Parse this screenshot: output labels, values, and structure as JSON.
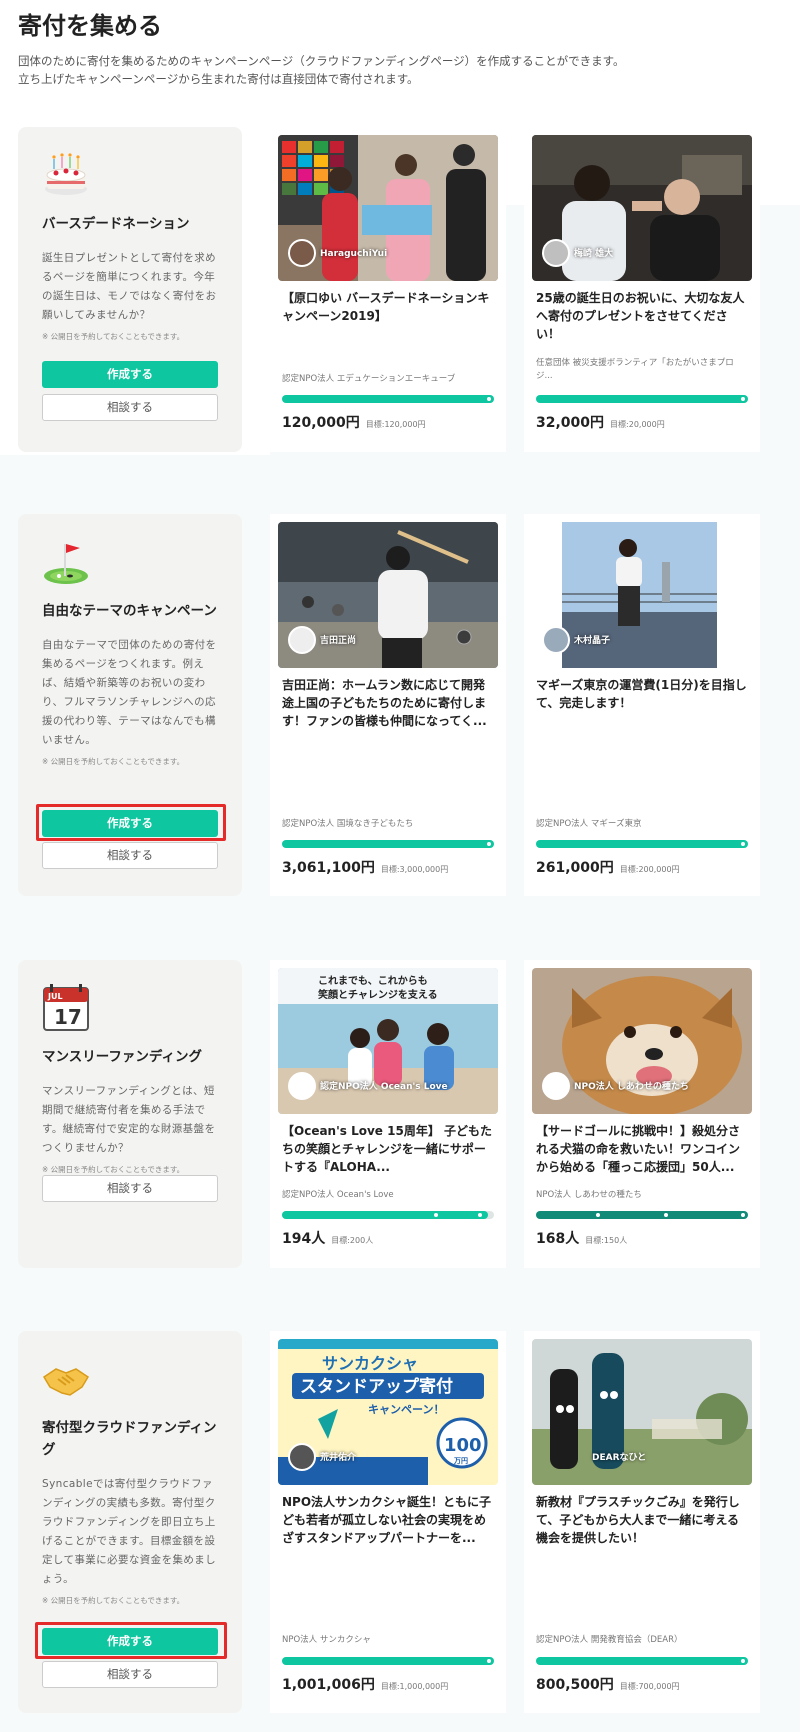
{
  "page": {
    "title": "寄付を集める",
    "intro_line1": "団体のために寄付を集めるためのキャンペーンページ（クラウドファンディングページ）を作成することができます。",
    "intro_line2": "立ち上げたキャンペーンページから生まれた寄付は直接団体で寄付されます。"
  },
  "colors": {
    "accent": "#0ec6a0",
    "highlight": "#e52a2a",
    "side_bg": "#f3f4f2"
  },
  "sections": [
    {
      "icon": "birthday-cake-icon",
      "title": "バースデードネーション",
      "desc": "誕生日プレゼントとして寄付を求めるページを簡単につくれます。今年の誕生日は、モノではなく寄付をお願いしてみませんか？",
      "note": "※ 公開日を予約しておくこともできます。",
      "create_label": "作成する",
      "consult_label": "相談する",
      "cards": [
        {
          "owner": "HaraguchiYui",
          "title": "【原口ゆい バースデードネーションキャンペーン2019】",
          "org": "認定NPO法人 エデュケーションエーキューブ",
          "amount": "120,000円",
          "goal": "目標:120,000円",
          "progress": 1.0
        },
        {
          "owner": "梅崎 雄大",
          "title": "25歳の誕生日のお祝いに、大切な友人へ寄付のプレゼントをさせてください！",
          "org": "任意団体 被災支援ボランティア「おたがいさまプロジ...",
          "amount": "32,000円",
          "goal": "目標:20,000円",
          "progress": 1.0
        }
      ]
    },
    {
      "icon": "golf-flag-icon",
      "title": "自由なテーマのキャンペーン",
      "desc": "自由なテーマで団体のための寄付を集めるページをつくれます。例えば、結婚や新築等のお祝いの変わり、フルマラソンチャレンジへの応援の代わり等、テーマはなんでも構いません。",
      "note": "※ 公開日を予約しておくこともできます。",
      "create_label": "作成する",
      "consult_label": "相談する",
      "cards": [
        {
          "owner": "吉田正尚",
          "title": "吉田正尚：ホームラン数に応じて開発途上国の子どもたちのために寄付します！ファンの皆様も仲間になってく...",
          "org": "認定NPO法人 国境なき子どもたち",
          "amount": "3,061,100円",
          "goal": "目標:3,000,000円",
          "progress": 1.0
        },
        {
          "owner": "木村晶子",
          "title": "マギーズ東京の運営費(1日分)を目指して、完走します！",
          "org": "認定NPO法人 マギーズ東京",
          "amount": "261,000円",
          "goal": "目標:200,000円",
          "progress": 1.0
        }
      ]
    },
    {
      "icon": "calendar-icon",
      "calendar_month": "JUL",
      "calendar_day": "17",
      "title": "マンスリーファンディング",
      "desc": "マンスリーファンディングとは、短期間で継続寄付者を集める手法です。継続寄付で安定的な財源基盤をつくりませんか？",
      "note": "※ 公開日を予約しておくこともできます。",
      "consult_label": "相談する",
      "cards": [
        {
          "owner": "認定NPO法人 Ocean's Love",
          "img_text1": "これまでも、これからも",
          "img_text2": "笑顔とチャレンジを支える",
          "title": "【Ocean's Love 15周年】 子どもたちの笑顔とチャレンジを一緒にサポートする『ALOHA...",
          "org": "認定NPO法人 Ocean's Love",
          "amount": "194人",
          "goal": "目標:200人",
          "progress": 0.97
        },
        {
          "owner": "NPO法人 しあわせの種たち",
          "title": "【サードゴールに挑戦中！】殺処分される犬猫の命を救いたい！ワンコインから始める「種っこ応援団」50人...",
          "org": "NPO法人 しあわせの種たち",
          "amount": "168人",
          "goal": "目標:150人",
          "progress": 1.0
        }
      ]
    },
    {
      "icon": "handshake-icon",
      "title": "寄付型クラウドファンディング",
      "desc": "Syncableでは寄付型クラウドファンディングの実績も多数。寄付型クラウドファンディングを即日立ち上げることができます。目標金額を設定して事業に必要な資金を集めましょう。",
      "note": "※ 公開日を予約しておくこともできます。",
      "create_label": "作成する",
      "consult_label": "相談する",
      "cards": [
        {
          "owner": "荒井佑介",
          "img_text1": "サンカクシャ",
          "img_text2": "スタンドアップ寄付",
          "img_text3": "キャンペーン！",
          "img_text4": "100",
          "img_text5": "万円",
          "title": "NPO法人サンカクシャ誕生！ともに子ども若者が孤立しない社会の実現をめざすスタンドアップパートナーを...",
          "org": "NPO法人 サンカクシャ",
          "amount": "1,001,006円",
          "goal": "目標:1,000,000円",
          "progress": 1.0
        },
        {
          "owner": "DEARなひと",
          "title": "新教材『プラスチックごみ』を発行して、子どもから大人まで一緒に考える機会を提供したい！",
          "org": "認定NPO法人 開発教育協会（DEAR）",
          "amount": "800,500円",
          "goal": "目標:700,000円",
          "progress": 1.0
        }
      ]
    }
  ]
}
